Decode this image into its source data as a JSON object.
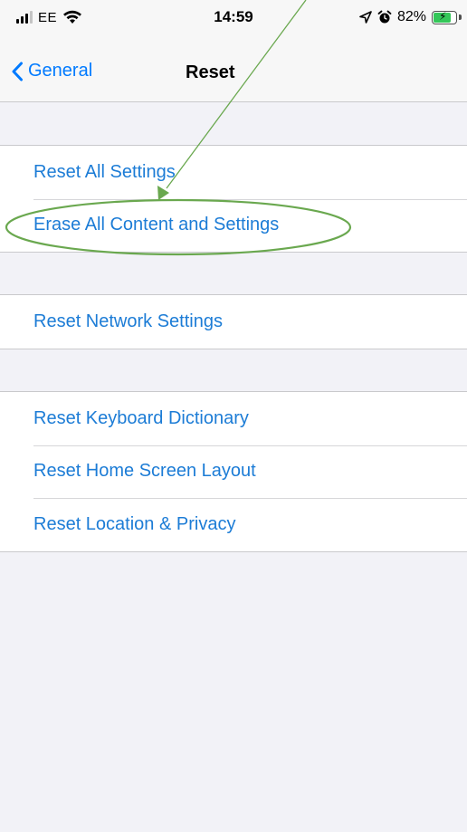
{
  "status_bar": {
    "carrier": "EE",
    "time": "14:59",
    "battery_percent": "82%",
    "battery_level": 0.82,
    "icons": [
      "signal-icon",
      "wifi-icon",
      "location-icon",
      "alarm-icon",
      "battery-charging-icon"
    ]
  },
  "nav": {
    "back_label": "General",
    "title": "Reset"
  },
  "groups": [
    {
      "items": [
        "Reset All Settings",
        "Erase All Content and Settings"
      ]
    },
    {
      "items": [
        "Reset Network Settings"
      ]
    },
    {
      "items": [
        "Reset Keyboard Dictionary",
        "Reset Home Screen Layout",
        "Reset Location & Privacy"
      ]
    }
  ],
  "annotation": {
    "color": "#6aa84f",
    "highlighted_item": "Erase All Content and Settings"
  },
  "colors": {
    "accent": "#007aff",
    "row_text": "#1c7cd6",
    "background": "#f2f2f7"
  }
}
